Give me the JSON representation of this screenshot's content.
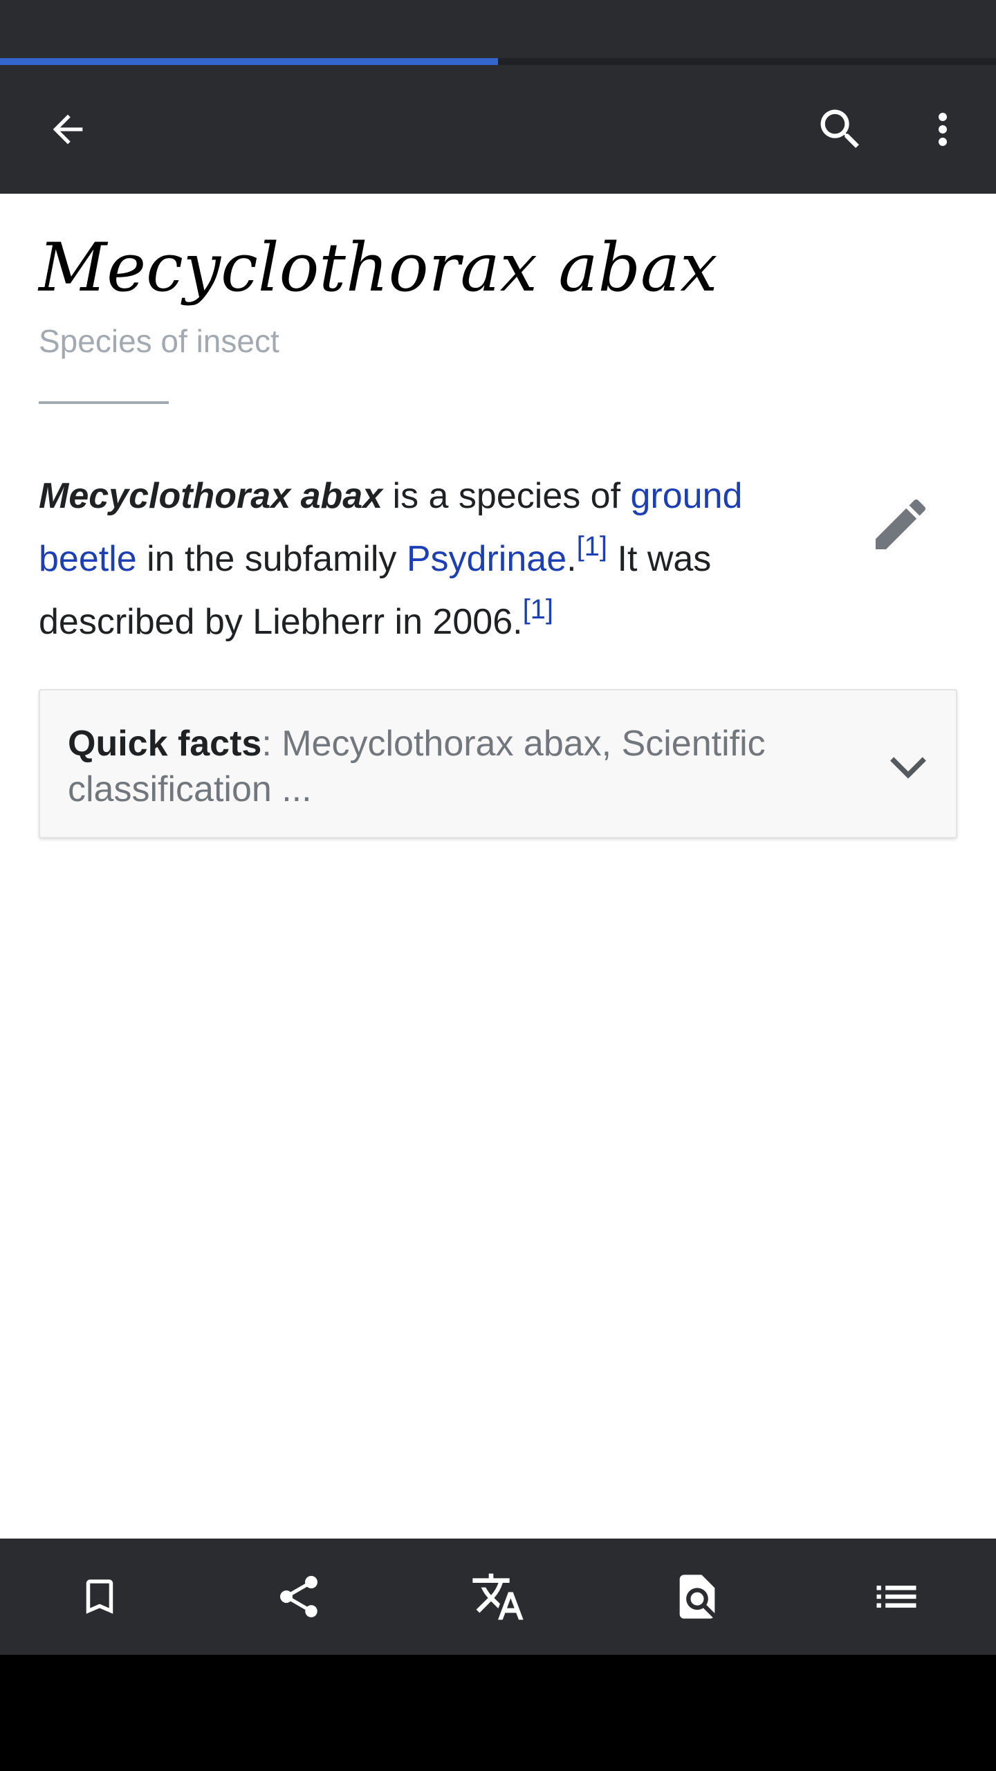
{
  "page_load_progress": 0.5,
  "toolbar": {
    "back_icon": "arrow-left-icon",
    "search_icon": "search-icon",
    "overflow_icon": "more-vert-icon"
  },
  "article": {
    "title": "Mecyclothorax abax",
    "description": "Species of insect",
    "lead": {
      "subject": "Mecyclothorax abax",
      "t1": " is a species of ",
      "link_ground_beetle_a": "ground",
      "link_ground_beetle_b": "beetle",
      "t2": " in the subfamily ",
      "link_psydrinae": "Psydrinae",
      "t3": ".",
      "ref1": "[1]",
      "t4": " It was described by Liebherr in 2006.",
      "ref2": "[1]"
    },
    "edit_icon": "pencil-icon"
  },
  "quick_facts": {
    "label": "Quick facts",
    "summary": ": Mecyclothorax abax, Scientific classification ...",
    "chevron_icon": "chevron-down-icon"
  },
  "bottom_bar": {
    "items": [
      {
        "icon": "bookmark-icon"
      },
      {
        "icon": "share-icon"
      },
      {
        "icon": "translate-icon"
      },
      {
        "icon": "find-in-page-icon"
      },
      {
        "icon": "table-of-contents-icon"
      }
    ]
  },
  "colors": {
    "link": "#1c3fb5",
    "chrome": "#2b2c2f",
    "progress": "#3366cc",
    "muted": "#a2a9b1"
  }
}
